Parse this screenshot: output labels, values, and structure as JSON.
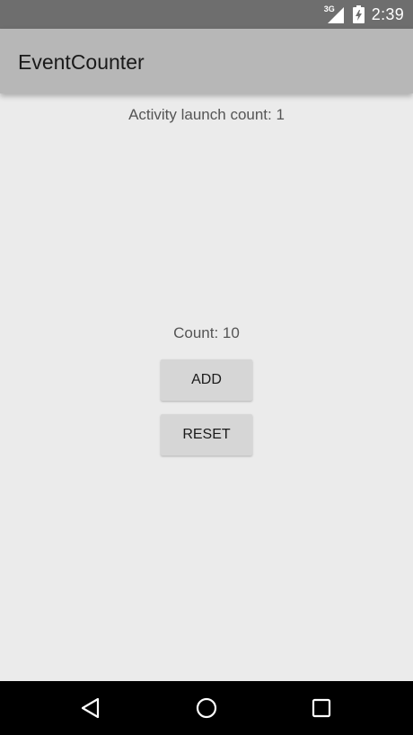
{
  "status_bar": {
    "network_type": "3G",
    "time": "2:39",
    "icons": [
      "signal-icon",
      "battery-icon"
    ]
  },
  "app_bar": {
    "title": "EventCounter"
  },
  "content": {
    "launch_count_text": "Activity launch count: 1",
    "count_text": "Count: 10",
    "add_button_label": "ADD",
    "reset_button_label": "RESET"
  },
  "nav_bar": {
    "icons": [
      "back-icon",
      "home-icon",
      "recents-icon"
    ]
  },
  "colors": {
    "status_bar": "#6e6e6e",
    "app_bar": "#b7b7b7",
    "background": "#ebebeb",
    "button": "#d6d6d6",
    "nav_bar": "#000000"
  }
}
